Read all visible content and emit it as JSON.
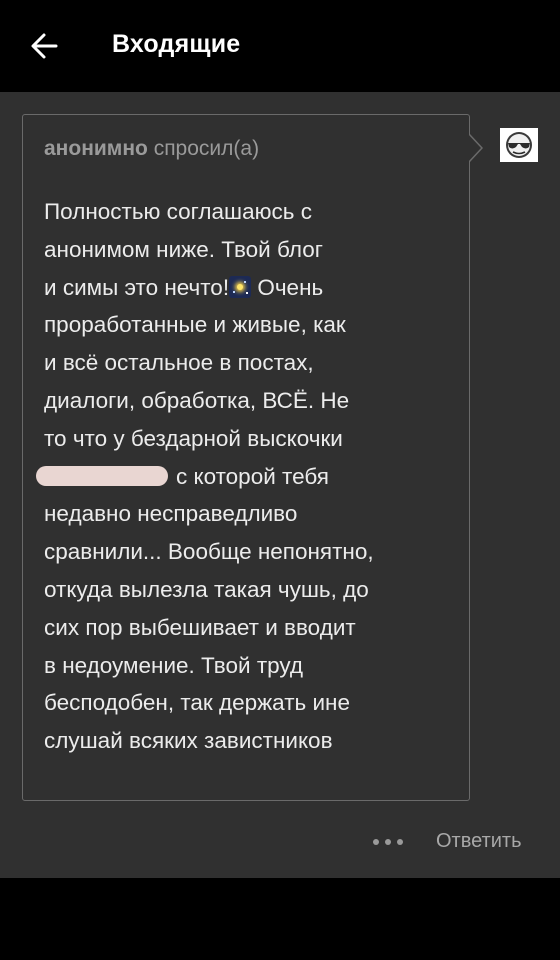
{
  "appbar": {
    "title": "Входящие",
    "back_icon": "arrow-left-icon"
  },
  "question": {
    "asker_name": "анонимно",
    "asker_verb": "спросил(а)",
    "lines": [
      "Полностью соглашаюсь с",
      "анонимом ниже. Твой блог",
      "и симы это нечто!",
      " Очень",
      "проработанные и живые, как",
      "и всё остальное в постах,",
      "диалоги, обработка, ВСЁ. Не",
      "то что у бездарной выскочки",
      "с которой тебя",
      "недавно несправедливо",
      "сравнили... Вообще непонятно,",
      "откуда вылезла такая чушь, до",
      "сих пор выбешивает и вводит",
      "в недоумение. Твой труд",
      "бесподобен, так держать ине",
      "слушай всяких завистников"
    ],
    "emoji_icon": "night-sky-sparkle-icon",
    "redacted_name": "redacted-username-blur"
  },
  "avatar": {
    "icon": "sunglasses-face-icon"
  },
  "actions": {
    "more_icon": "more-dots-icon",
    "reply_label": "Ответить"
  },
  "colors": {
    "background": "#000000",
    "card": "#303030",
    "border": "#6a6a6a",
    "text": "#ececec",
    "muted": "#9a9a9a"
  }
}
